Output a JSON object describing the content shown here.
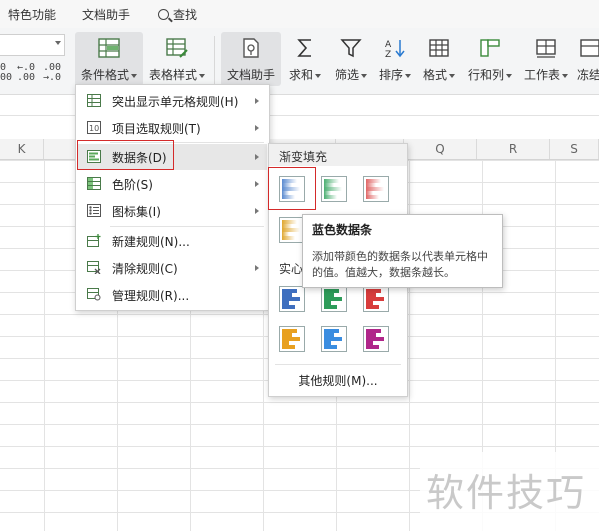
{
  "menubar": {
    "items": [
      "特色功能",
      "文档助手"
    ],
    "search_label": "查找"
  },
  "ribbon": {
    "numfmt_left": "0\n00",
    "numfmt_inc": "←.0\n.00",
    "numfmt_dec": ".00\n→.0",
    "buttons": {
      "conditional_format": "条件格式",
      "table_style": "表格样式",
      "doc_assistant": "文档助手",
      "sum": "求和",
      "filter": "筛选",
      "sort": "排序",
      "format": "格式",
      "row_col": "行和列",
      "worksheet": "工作表",
      "freeze": "冻结"
    }
  },
  "columns": [
    "K",
    "",
    "",
    "",
    "",
    "",
    "Q",
    "R",
    "S"
  ],
  "menu": {
    "items": [
      {
        "label": "突出显示单元格规则(H)",
        "has_submenu": true
      },
      {
        "label": "项目选取规则(T)",
        "has_submenu": true
      },
      {
        "label": "数据条(D)",
        "has_submenu": true,
        "highlighted": true
      },
      {
        "label": "色阶(S)",
        "has_submenu": true
      },
      {
        "label": "图标集(I)",
        "has_submenu": true
      },
      {
        "label": "新建规则(N)...",
        "has_submenu": false
      },
      {
        "label": "清除规则(C)",
        "has_submenu": true
      },
      {
        "label": "管理规则(R)...",
        "has_submenu": false
      }
    ]
  },
  "submenu": {
    "gradient_title": "渐变填充",
    "solid_title": "实心",
    "more_rules": "其他规则(M)...",
    "gradient_colors": [
      "#5b8bd0",
      "#4caf72",
      "#e06666",
      "#e0a830"
    ],
    "solid_colors": [
      "#3f6fbf",
      "#2e9c5a",
      "#d83c3c",
      "#e8a020",
      "#3a8de0",
      "#b0268a"
    ]
  },
  "tooltip": {
    "title": "蓝色数据条",
    "description": "添加带颜色的数据条以代表单元格中的值。值越大，数据条越长。"
  },
  "watermark": "软件技巧"
}
